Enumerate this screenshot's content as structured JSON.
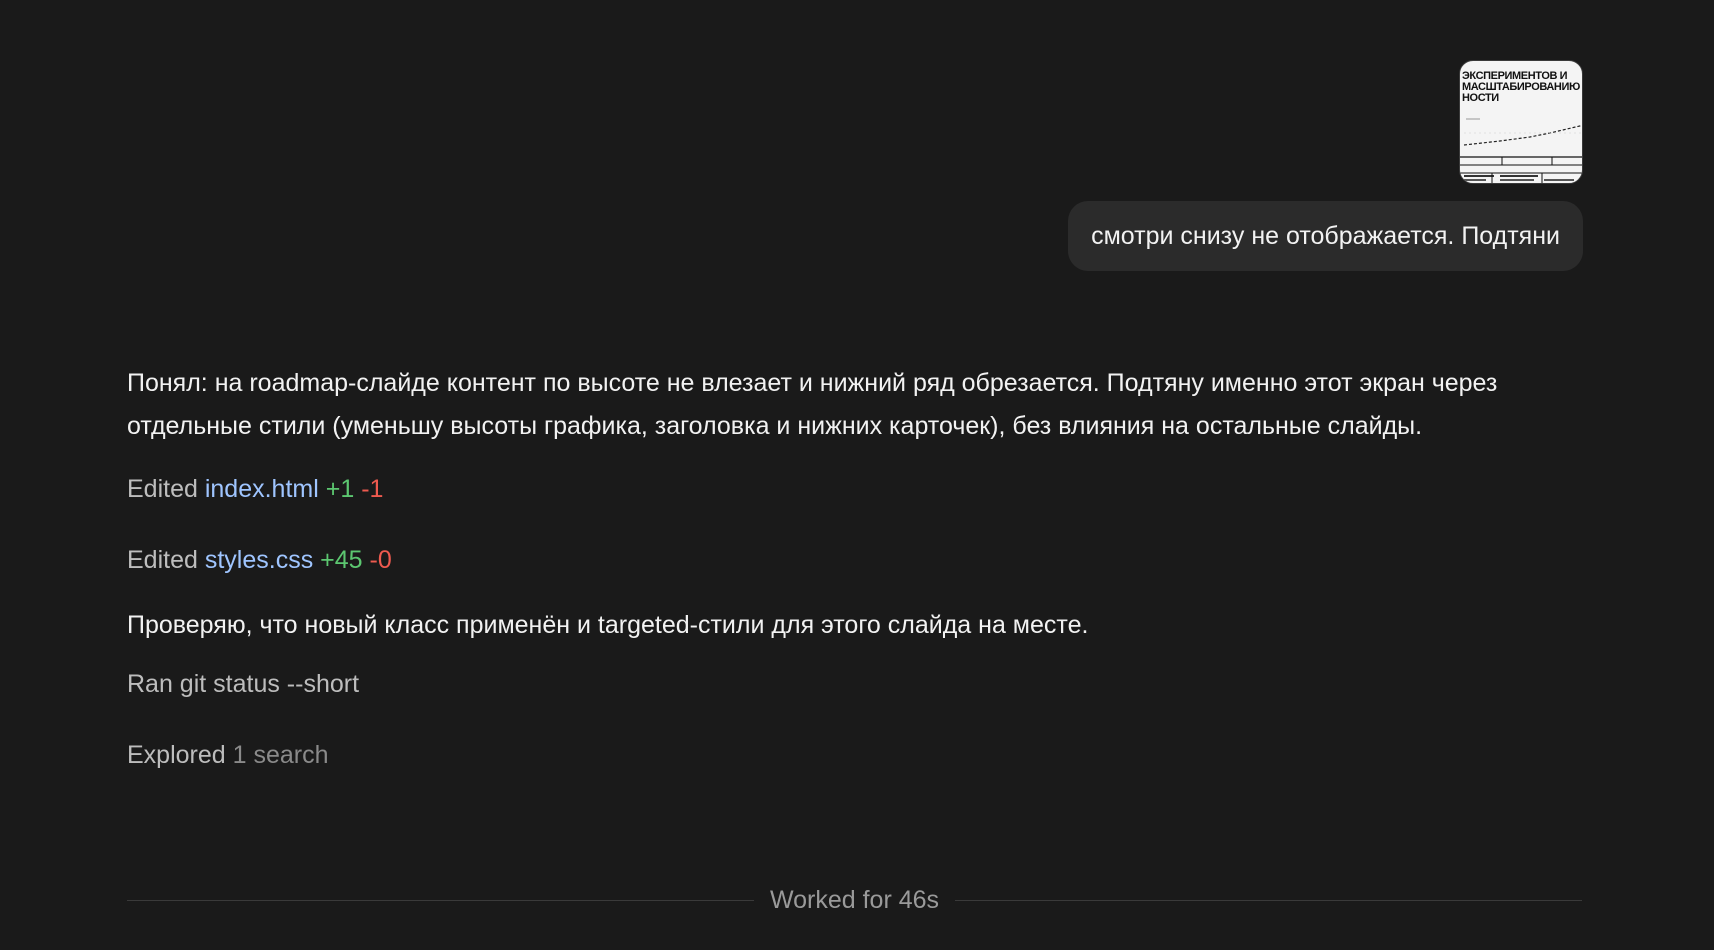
{
  "user_message": {
    "attachment_icon": "slide-thumbnail-image",
    "attachment_title": "ЭКСПЕРИМЕНТОВ И\nМАСШТАБИРОВАНИЮ\nНОСТИ",
    "text": "смотри снизу не отображается. Подтяни"
  },
  "assistant": {
    "intro": "Понял: на roadmap-слайде контент по высоте не влезает и нижний ряд обрезается. Подтяну именно этот экран через отдельные стили (уменьшу высоты графика, заголовка и нижних карточек), без влияния на остальные слайды.",
    "edits": [
      {
        "verb": "Edited",
        "file": "index.html",
        "added": "+1",
        "removed": "-1"
      },
      {
        "verb": "Edited",
        "file": "styles.css",
        "added": "+45",
        "removed": "-0"
      }
    ],
    "check": "Проверяю, что новый класс применён и targeted-стили для этого слайда на месте.",
    "ran": "Ran git status --short",
    "explored_verb": "Explored",
    "explored_detail": "1 search"
  },
  "footer": {
    "worked": "Worked for 46s"
  },
  "colors": {
    "background": "#1a1a1a",
    "bubble": "#2b2b2b",
    "file_link": "#9fc5ff",
    "added": "#5cc770",
    "removed": "#ee5a4f"
  }
}
